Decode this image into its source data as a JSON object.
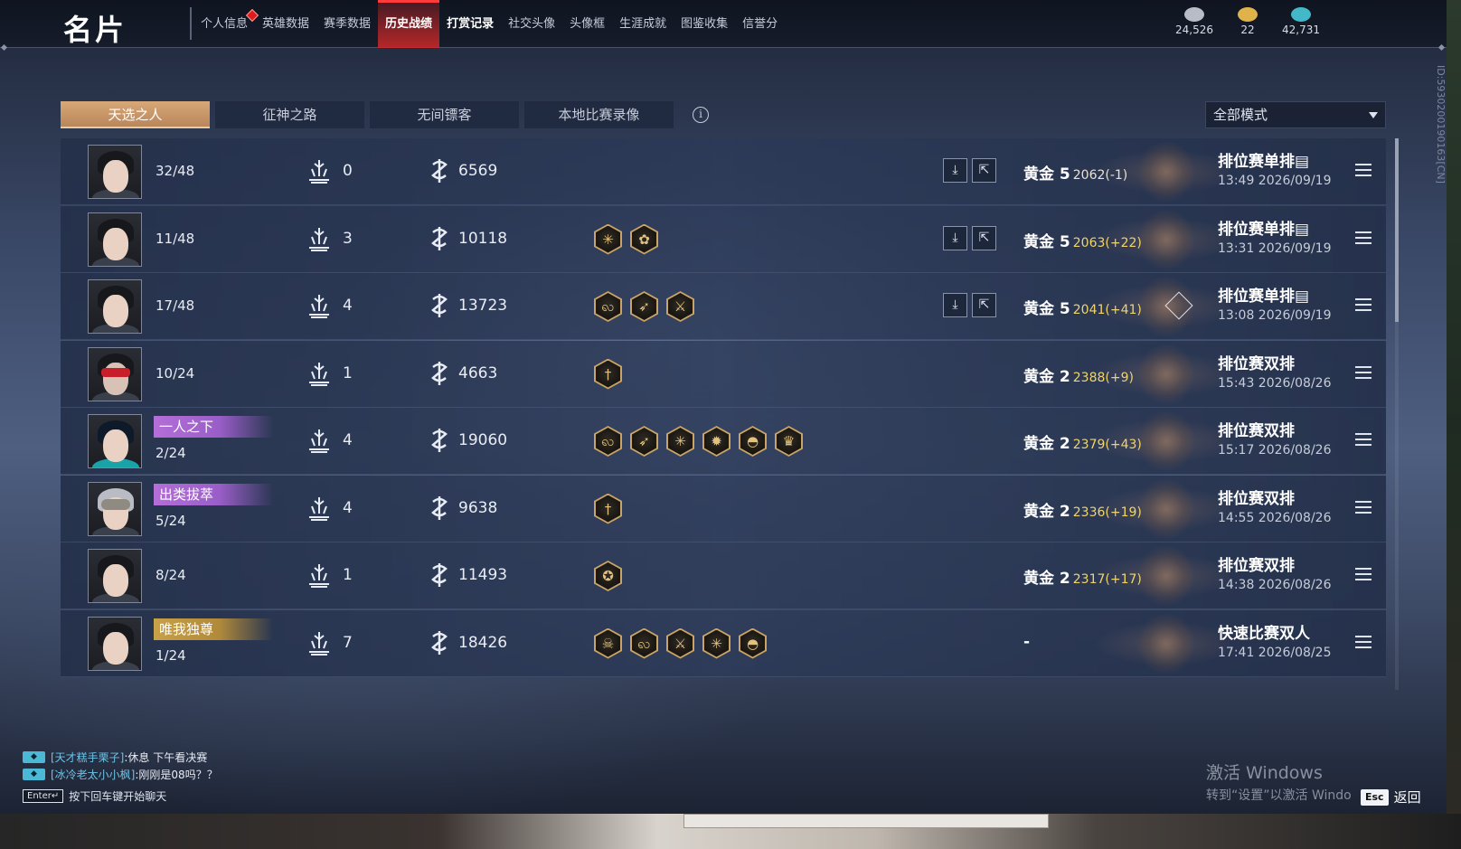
{
  "app_title": "名片",
  "nav_tabs": [
    {
      "label": "个人信息",
      "badge": true
    },
    {
      "label": "英雄数据"
    },
    {
      "label": "赛季数据"
    },
    {
      "label": "历史战绩",
      "active": true
    },
    {
      "label": "打赏记录",
      "bold": true
    },
    {
      "label": "社交头像"
    },
    {
      "label": "头像框"
    },
    {
      "label": "生涯成就"
    },
    {
      "label": "图鉴收集"
    },
    {
      "label": "信誉分"
    }
  ],
  "currencies": [
    {
      "icon": "mask-coin-icon",
      "value": "24,526",
      "color": "#b7bcc6"
    },
    {
      "icon": "ticket-icon",
      "value": "22",
      "color": "#e0b24a"
    },
    {
      "icon": "feather-coin-icon",
      "value": "42,731",
      "color": "#42b8c9"
    }
  ],
  "filter_tabs": [
    "天选之人",
    "征神之路",
    "无间镖客",
    "本地比赛录像"
  ],
  "mode_select": {
    "value": "全部模式"
  },
  "matches": [
    {
      "avatar": "female-black-hair",
      "title": "",
      "rank": "32/48",
      "kills": "0",
      "damage": "6569",
      "badges": [],
      "has_actions": true,
      "tier": "黄金 5",
      "points": "2062(-1)",
      "gain": false,
      "mode": "排位赛单排",
      "mode_icon": "card-icon",
      "time": "13:49 2026/09/19",
      "diamond": false
    },
    {
      "avatar": "female-black-hair",
      "title": "",
      "rank": "11/48",
      "kills": "3",
      "damage": "10118",
      "badges": [
        "spark-medal",
        "lotus-medal"
      ],
      "has_actions": true,
      "tier": "黄金 5",
      "points": "2063(+22)",
      "gain": true,
      "mode": "排位赛单排",
      "mode_icon": "card-icon",
      "time": "13:31 2026/09/19",
      "diamond": false
    },
    {
      "avatar": "female-black-hair",
      "title": "",
      "rank": "17/48",
      "kills": "4",
      "damage": "13723",
      "badges": [
        "dragon-medal",
        "bow-medal",
        "sword-medal"
      ],
      "has_actions": true,
      "tier": "黄金 5",
      "points": "2041(+41)",
      "gain": true,
      "mode": "排位赛单排",
      "mode_icon": "card-icon",
      "time": "13:08 2026/09/19",
      "diamond": true
    },
    {
      "avatar": "masked-red",
      "title": "",
      "rank": "10/24",
      "kills": "1",
      "damage": "4663",
      "badges": [
        "blade-medal"
      ],
      "has_actions": false,
      "tier": "黄金 2",
      "points": "2388(+9)",
      "gain": true,
      "mode": "排位赛双排",
      "mode_icon": "",
      "time": "15:43 2026/08/26",
      "diamond": false
    },
    {
      "avatar": "teal-hat",
      "title": "一人之下",
      "title_style": "purple",
      "rank": "2/24",
      "kills": "4",
      "damage": "19060",
      "badges": [
        "dragon-medal",
        "bow-medal",
        "spark-medal",
        "gear-medal",
        "helmet-medal",
        "crown-medal"
      ],
      "has_actions": false,
      "tier": "黄金 2",
      "points": "2379(+43)",
      "gain": true,
      "mode": "排位赛双排",
      "mode_icon": "",
      "time": "15:17 2026/08/26",
      "diamond": false
    },
    {
      "avatar": "helm-silver",
      "title": "出类拔萃",
      "title_style": "purple",
      "rank": "5/24",
      "kills": "4",
      "damage": "9638",
      "badges": [
        "blade-medal"
      ],
      "has_actions": false,
      "tier": "黄金 2",
      "points": "2336(+19)",
      "gain": true,
      "mode": "排位赛双排",
      "mode_icon": "",
      "time": "14:55 2026/08/26",
      "diamond": false
    },
    {
      "avatar": "female-black-hair",
      "title": "",
      "rank": "8/24",
      "kills": "1",
      "damage": "11493",
      "badges": [
        "star-medal"
      ],
      "has_actions": false,
      "tier": "黄金 2",
      "points": "2317(+17)",
      "gain": true,
      "mode": "排位赛双排",
      "mode_icon": "",
      "time": "14:38 2026/08/26",
      "diamond": false
    },
    {
      "avatar": "female-black-hair",
      "title": "唯我独尊",
      "title_style": "gold",
      "rank": "1/24",
      "kills": "7",
      "damage": "18426",
      "badges": [
        "skull-medal",
        "dragon-medal",
        "sword-medal",
        "spark-medal",
        "helmet-medal"
      ],
      "has_actions": false,
      "tier": "-",
      "points": "",
      "gain": false,
      "mode": "快速比赛双人",
      "mode_icon": "",
      "time": "17:41 2026/08/25",
      "diamond": false
    }
  ],
  "side_id": "ID:5930200190163[CN]",
  "chat": {
    "lines": [
      {
        "user": "[天才糕手栗子]",
        "message": ":休息  下午看决赛"
      },
      {
        "user": "[冰冷老太小小枫]",
        "message": ":刚刚是08吗？？"
      }
    ],
    "enter_key": "Enter↵",
    "input_hint": "按下回车键开始聊天"
  },
  "watermark": {
    "line1": "激活 Windows",
    "line2": "转到“设置”以激活 Windo"
  },
  "esc": {
    "key": "Esc",
    "label": "返回"
  }
}
